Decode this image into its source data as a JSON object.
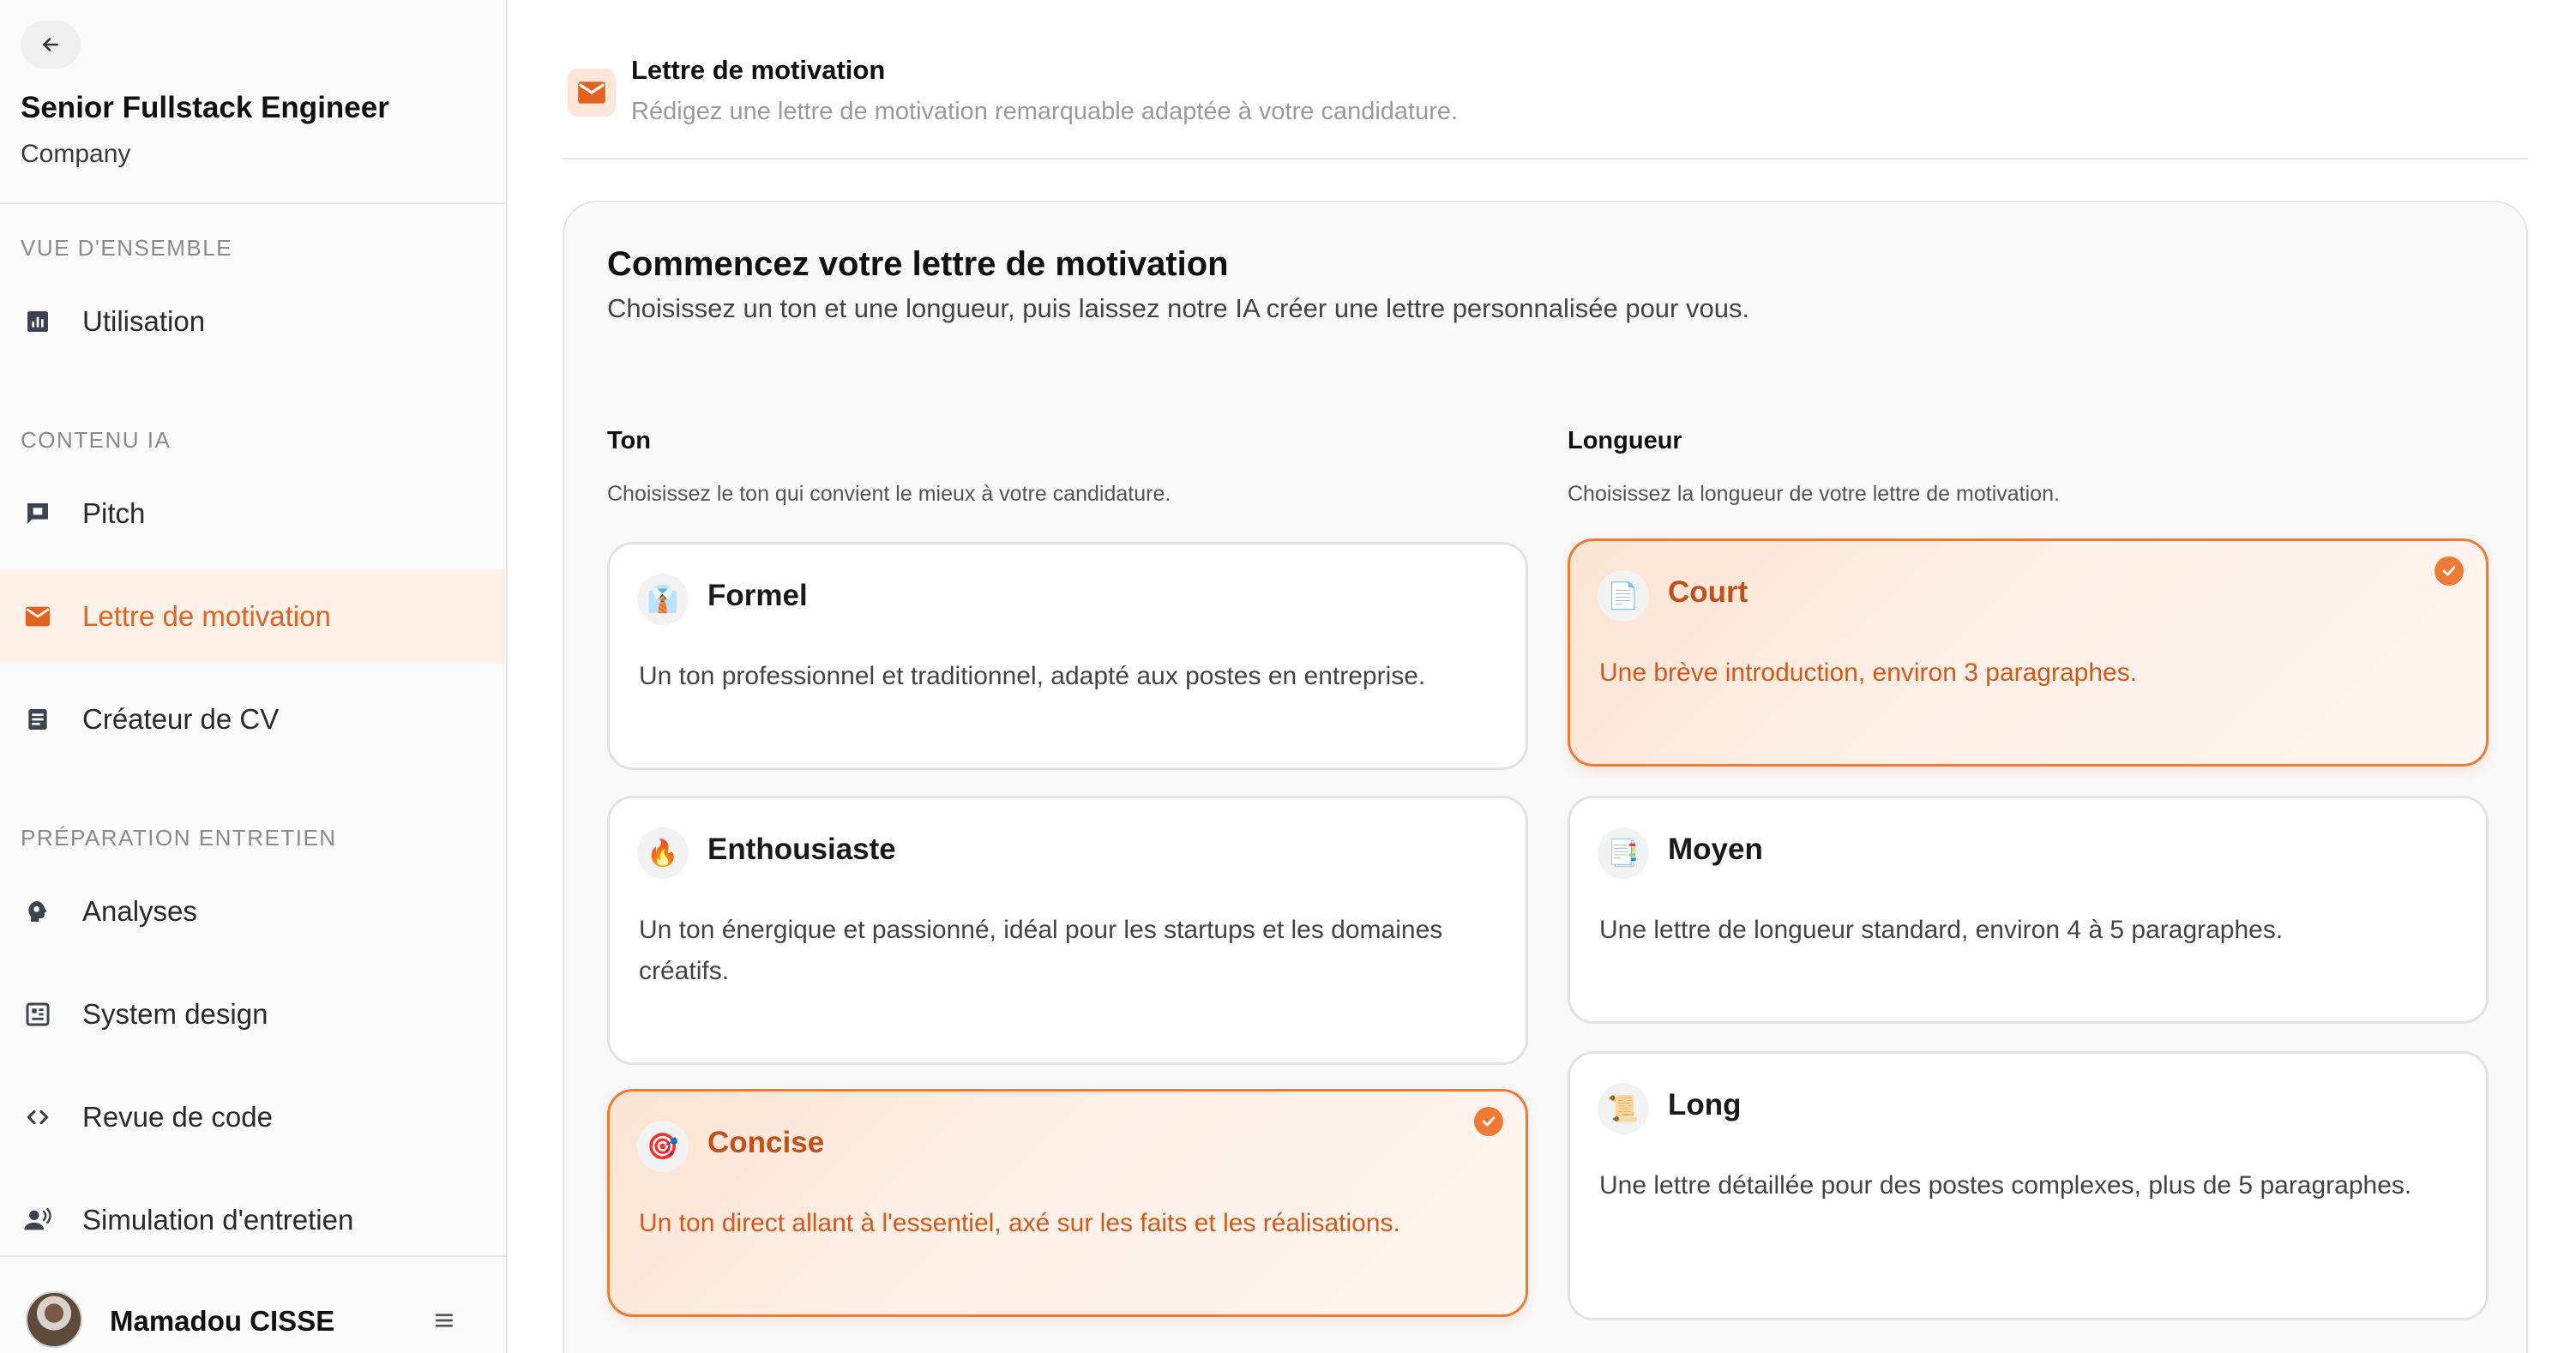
{
  "sidebar": {
    "job_title": "Senior Fullstack Engineer",
    "company": "Company",
    "sections": {
      "overview": "VUE D'ENSEMBLE",
      "ai_content": "CONTENU IA",
      "interview_prep": "PRÉPARATION ENTRETIEN"
    },
    "items": {
      "usage": "Utilisation",
      "pitch": "Pitch",
      "cover_letter": "Lettre de motivation",
      "cv_builder": "Créateur de CV",
      "analyses": "Analyses",
      "system_design": "System design",
      "code_review": "Revue de code",
      "interview_sim": "Simulation d'entretien"
    },
    "active_item": "cover_letter",
    "user_name": "Mamadou CISSE"
  },
  "header": {
    "title": "Lettre de motivation",
    "subtitle": "Rédigez une lettre de motivation remarquable adaptée à votre candidature."
  },
  "panel": {
    "title": "Commencez votre lettre de motivation",
    "subtitle": "Choisissez un ton et une longueur, puis laissez notre IA créer une lettre personnalisée pour vous."
  },
  "tone": {
    "label": "Ton",
    "hint": "Choisissez le ton qui convient le mieux à votre candidature.",
    "options": [
      {
        "title": "Formel",
        "icon": "👔",
        "desc": "Un ton professionnel et traditionnel, adapté aux postes en entreprise.",
        "selected": false
      },
      {
        "title": "Enthousiaste",
        "icon": "🔥",
        "desc": "Un ton énergique et passionné, idéal pour les startups et les domaines créatifs.",
        "selected": false
      },
      {
        "title": "Concise",
        "icon": "🎯",
        "desc": "Un ton direct allant à l'essentiel, axé sur les faits et les réalisations.",
        "selected": true
      }
    ]
  },
  "length": {
    "label": "Longueur",
    "hint": "Choisissez la longueur de votre lettre de motivation.",
    "options": [
      {
        "title": "Court",
        "icon": "📄",
        "desc": "Une brève introduction, environ 3 paragraphes.",
        "selected": true
      },
      {
        "title": "Moyen",
        "icon": "📑",
        "desc": "Une lettre de longueur standard, environ 4 à 5 paragraphes.",
        "selected": false
      },
      {
        "title": "Long",
        "icon": "📜",
        "desc": "Une lettre détaillée pour des postes complexes, plus de 5 paragraphes.",
        "selected": false
      }
    ]
  },
  "colors": {
    "accent": "#ef7a36",
    "accent_text": "#e4621f",
    "active_nav_bg": "#fdf1e7"
  }
}
